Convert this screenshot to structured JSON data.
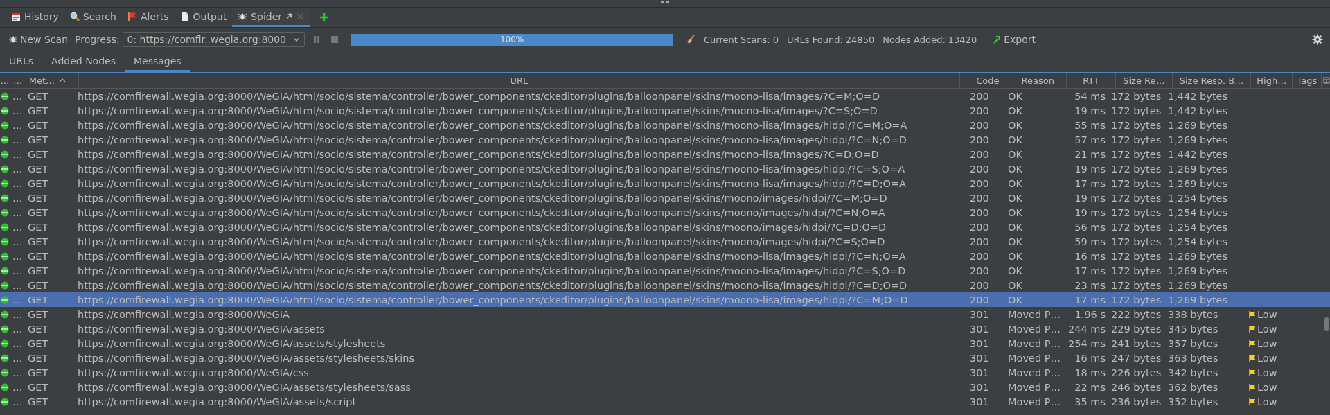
{
  "tabs": [
    {
      "label": "History",
      "kind": "calendar",
      "selected": false
    },
    {
      "label": "Search",
      "kind": "search",
      "selected": false
    },
    {
      "label": "Alerts",
      "kind": "flag",
      "selected": false
    },
    {
      "label": "Output",
      "kind": "document",
      "selected": false
    },
    {
      "label": "Spider",
      "kind": "spider",
      "selected": true,
      "pinned": true,
      "closable": true
    }
  ],
  "toolbar": {
    "new_scan": "New Scan",
    "progress_label": "Progress:",
    "scan_select": "0: https://comfir..wegia.org:8000",
    "progress": {
      "level": 1.0,
      "reading": "100%"
    },
    "stats": [
      {
        "label": "Current Scans:",
        "value": "0"
      },
      {
        "label": "URLs Found:",
        "value": "24850"
      },
      {
        "label": "Nodes Added:",
        "value": "13420"
      }
    ],
    "export": "Export"
  },
  "subtabs": [
    {
      "label": "URLs",
      "selected": false
    },
    {
      "label": "Added Nodes",
      "selected": false
    },
    {
      "label": "Messages",
      "selected": true
    }
  ],
  "table": {
    "columns": [
      {
        "label": "…",
        "sorted": false
      },
      {
        "label": "…",
        "sorted": false
      },
      {
        "label": "Met…",
        "sorted": true
      },
      {
        "label": "URL",
        "sorted": false
      },
      {
        "label": "Code",
        "sorted": false
      },
      {
        "label": "Reason",
        "sorted": false
      },
      {
        "label": "RTT",
        "sorted": false
      },
      {
        "label": "Size Re…",
        "sorted": false
      },
      {
        "label": "Size Resp. B…",
        "sorted": false
      },
      {
        "label": "High…",
        "sorted": false
      },
      {
        "label": "Tags",
        "sorted": false
      }
    ],
    "rows": [
      {
        "col_2": "…",
        "method": "GET",
        "url": "https://comfirewall.wegia.org:8000/WeGIA/html/socio/sistema/controller/bower_components/ckeditor/plugins/balloonpanel/skins/moono-lisa/images/?C=M;O=D",
        "code": "200",
        "reason": "OK",
        "rtt": "54 ms",
        "size_req": "172 bytes",
        "size_resp": "1,442 bytes",
        "selected": false
      },
      {
        "col_2": "…",
        "method": "GET",
        "url": "https://comfirewall.wegia.org:8000/WeGIA/html/socio/sistema/controller/bower_components/ckeditor/plugins/balloonpanel/skins/moono-lisa/images/?C=S;O=D",
        "code": "200",
        "reason": "OK",
        "rtt": "19 ms",
        "size_req": "172 bytes",
        "size_resp": "1,442 bytes",
        "selected": false
      },
      {
        "col_2": "…",
        "method": "GET",
        "url": "https://comfirewall.wegia.org:8000/WeGIA/html/socio/sistema/controller/bower_components/ckeditor/plugins/balloonpanel/skins/moono-lisa/images/hidpi/?C=M;O=A",
        "code": "200",
        "reason": "OK",
        "rtt": "55 ms",
        "size_req": "172 bytes",
        "size_resp": "1,269 bytes",
        "selected": false
      },
      {
        "col_2": "…",
        "method": "GET",
        "url": "https://comfirewall.wegia.org:8000/WeGIA/html/socio/sistema/controller/bower_components/ckeditor/plugins/balloonpanel/skins/moono-lisa/images/hidpi/?C=N;O=D",
        "code": "200",
        "reason": "OK",
        "rtt": "57 ms",
        "size_req": "172 bytes",
        "size_resp": "1,269 bytes",
        "selected": false
      },
      {
        "col_2": "…",
        "method": "GET",
        "url": "https://comfirewall.wegia.org:8000/WeGIA/html/socio/sistema/controller/bower_components/ckeditor/plugins/balloonpanel/skins/moono-lisa/images/?C=D;O=D",
        "code": "200",
        "reason": "OK",
        "rtt": "21 ms",
        "size_req": "172 bytes",
        "size_resp": "1,442 bytes",
        "selected": false
      },
      {
        "col_2": "…",
        "method": "GET",
        "url": "https://comfirewall.wegia.org:8000/WeGIA/html/socio/sistema/controller/bower_components/ckeditor/plugins/balloonpanel/skins/moono-lisa/images/hidpi/?C=S;O=A",
        "code": "200",
        "reason": "OK",
        "rtt": "19 ms",
        "size_req": "172 bytes",
        "size_resp": "1,269 bytes",
        "selected": false
      },
      {
        "col_2": "…",
        "method": "GET",
        "url": "https://comfirewall.wegia.org:8000/WeGIA/html/socio/sistema/controller/bower_components/ckeditor/plugins/balloonpanel/skins/moono-lisa/images/hidpi/?C=D;O=A",
        "code": "200",
        "reason": "OK",
        "rtt": "17 ms",
        "size_req": "172 bytes",
        "size_resp": "1,269 bytes",
        "selected": false
      },
      {
        "col_2": "…",
        "method": "GET",
        "url": "https://comfirewall.wegia.org:8000/WeGIA/html/socio/sistema/controller/bower_components/ckeditor/plugins/balloonpanel/skins/moono/images/hidpi/?C=M;O=D",
        "code": "200",
        "reason": "OK",
        "rtt": "19 ms",
        "size_req": "172 bytes",
        "size_resp": "1,254 bytes",
        "selected": false
      },
      {
        "col_2": "…",
        "method": "GET",
        "url": "https://comfirewall.wegia.org:8000/WeGIA/html/socio/sistema/controller/bower_components/ckeditor/plugins/balloonpanel/skins/moono/images/hidpi/?C=N;O=A",
        "code": "200",
        "reason": "OK",
        "rtt": "19 ms",
        "size_req": "172 bytes",
        "size_resp": "1,254 bytes",
        "selected": false
      },
      {
        "col_2": "…",
        "method": "GET",
        "url": "https://comfirewall.wegia.org:8000/WeGIA/html/socio/sistema/controller/bower_components/ckeditor/plugins/balloonpanel/skins/moono/images/hidpi/?C=D;O=D",
        "code": "200",
        "reason": "OK",
        "rtt": "56 ms",
        "size_req": "172 bytes",
        "size_resp": "1,254 bytes",
        "selected": false
      },
      {
        "col_2": "…",
        "method": "GET",
        "url": "https://comfirewall.wegia.org:8000/WeGIA/html/socio/sistema/controller/bower_components/ckeditor/plugins/balloonpanel/skins/moono/images/hidpi/?C=S;O=D",
        "code": "200",
        "reason": "OK",
        "rtt": "59 ms",
        "size_req": "172 bytes",
        "size_resp": "1,254 bytes",
        "selected": false
      },
      {
        "col_2": "…",
        "method": "GET",
        "url": "https://comfirewall.wegia.org:8000/WeGIA/html/socio/sistema/controller/bower_components/ckeditor/plugins/balloonpanel/skins/moono-lisa/images/hidpi/?C=N;O=A",
        "code": "200",
        "reason": "OK",
        "rtt": "16 ms",
        "size_req": "172 bytes",
        "size_resp": "1,269 bytes",
        "selected": false
      },
      {
        "col_2": "…",
        "method": "GET",
        "url": "https://comfirewall.wegia.org:8000/WeGIA/html/socio/sistema/controller/bower_components/ckeditor/plugins/balloonpanel/skins/moono-lisa/images/hidpi/?C=S;O=D",
        "code": "200",
        "reason": "OK",
        "rtt": "17 ms",
        "size_req": "172 bytes",
        "size_resp": "1,269 bytes",
        "selected": false
      },
      {
        "col_2": "…",
        "method": "GET",
        "url": "https://comfirewall.wegia.org:8000/WeGIA/html/socio/sistema/controller/bower_components/ckeditor/plugins/balloonpanel/skins/moono-lisa/images/hidpi/?C=D;O=D",
        "code": "200",
        "reason": "OK",
        "rtt": "23 ms",
        "size_req": "172 bytes",
        "size_resp": "1,269 bytes",
        "selected": false
      },
      {
        "col_2": "…",
        "method": "GET",
        "url": "https://comfirewall.wegia.org:8000/WeGIA/html/socio/sistema/controller/bower_components/ckeditor/plugins/balloonpanel/skins/moono-lisa/images/hidpi/?C=M;O=D",
        "code": "200",
        "reason": "OK",
        "rtt": "17 ms",
        "size_req": "172 bytes",
        "size_resp": "1,269 bytes",
        "selected": true
      },
      {
        "col_2": "…",
        "method": "GET",
        "url": "https://comfirewall.wegia.org:8000/WeGIA",
        "code": "301",
        "reason": "Moved P…",
        "rtt": "1.96 s",
        "size_req": "222 bytes",
        "size_resp": "338 bytes",
        "alert": "Low",
        "selected": false
      },
      {
        "col_2": "…",
        "method": "GET",
        "url": "https://comfirewall.wegia.org:8000/WeGIA/assets",
        "code": "301",
        "reason": "Moved P…",
        "rtt": "244 ms",
        "size_req": "229 bytes",
        "size_resp": "345 bytes",
        "alert": "Low",
        "selected": false
      },
      {
        "col_2": "…",
        "method": "GET",
        "url": "https://comfirewall.wegia.org:8000/WeGIA/assets/stylesheets",
        "code": "301",
        "reason": "Moved P…",
        "rtt": "254 ms",
        "size_req": "241 bytes",
        "size_resp": "357 bytes",
        "alert": "Low",
        "selected": false
      },
      {
        "col_2": "…",
        "method": "GET",
        "url": "https://comfirewall.wegia.org:8000/WeGIA/assets/stylesheets/skins",
        "code": "301",
        "reason": "Moved P…",
        "rtt": "16 ms",
        "size_req": "247 bytes",
        "size_resp": "363 bytes",
        "alert": "Low",
        "selected": false
      },
      {
        "col_2": "…",
        "method": "GET",
        "url": "https://comfirewall.wegia.org:8000/WeGIA/css",
        "code": "301",
        "reason": "Moved P…",
        "rtt": "18 ms",
        "size_req": "226 bytes",
        "size_resp": "342 bytes",
        "alert": "Low",
        "selected": false
      },
      {
        "col_2": "…",
        "method": "GET",
        "url": "https://comfirewall.wegia.org:8000/WeGIA/assets/stylesheets/sass",
        "code": "301",
        "reason": "Moved P…",
        "rtt": "22 ms",
        "size_req": "246 bytes",
        "size_resp": "362 bytes",
        "alert": "Low",
        "selected": false
      },
      {
        "col_2": "…",
        "method": "GET",
        "url": "https://comfirewall.wegia.org:8000/WeGIA/assets/script",
        "code": "301",
        "reason": "Moved P…",
        "rtt": "35 ms",
        "size_req": "236 bytes",
        "size_resp": "352 bytes",
        "alert": "Low",
        "selected": false
      }
    ]
  }
}
